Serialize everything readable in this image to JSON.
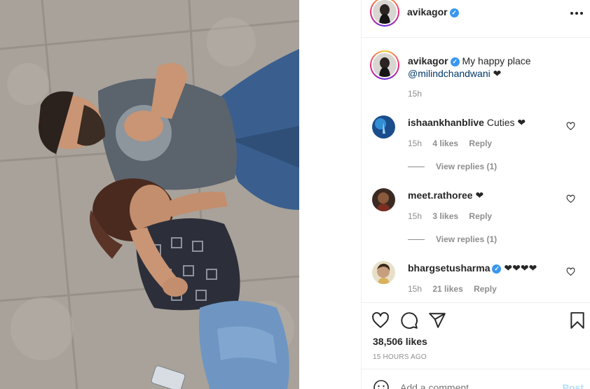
{
  "post": {
    "author": "avikagor",
    "verified_mark": "✓",
    "more_icon": "more-options-icon",
    "caption_text": "My happy place",
    "caption_mention": "@milindchandwani",
    "caption_emoji": "❤",
    "caption_time": "15h",
    "likes": "38,506 likes",
    "time_ago": "15 HOURS AGO"
  },
  "comments": [
    {
      "user": "ishaankhanblive",
      "verified": false,
      "text": "Cuties ❤",
      "time": "15h",
      "likes": "4 likes",
      "reply": "Reply",
      "view_replies": "View replies (1)"
    },
    {
      "user": "meet.rathoree",
      "verified": false,
      "text": "❤",
      "time": "15h",
      "likes": "3 likes",
      "reply": "Reply",
      "view_replies": "View replies (1)"
    },
    {
      "user": "bhargsetusharma",
      "verified": true,
      "text": "❤❤❤❤",
      "time": "15h",
      "likes": "21 likes",
      "reply": "Reply"
    }
  ],
  "composer": {
    "placeholder": "Add a comment...",
    "post_label": "Post"
  },
  "colors": {
    "verified": "#3897f0",
    "mention": "#00376b",
    "muted": "#8e8e8e",
    "post_disabled": "#b2dffc"
  },
  "icons": [
    "heart-icon",
    "comment-icon",
    "share-icon",
    "bookmark-icon",
    "emoji-icon"
  ]
}
